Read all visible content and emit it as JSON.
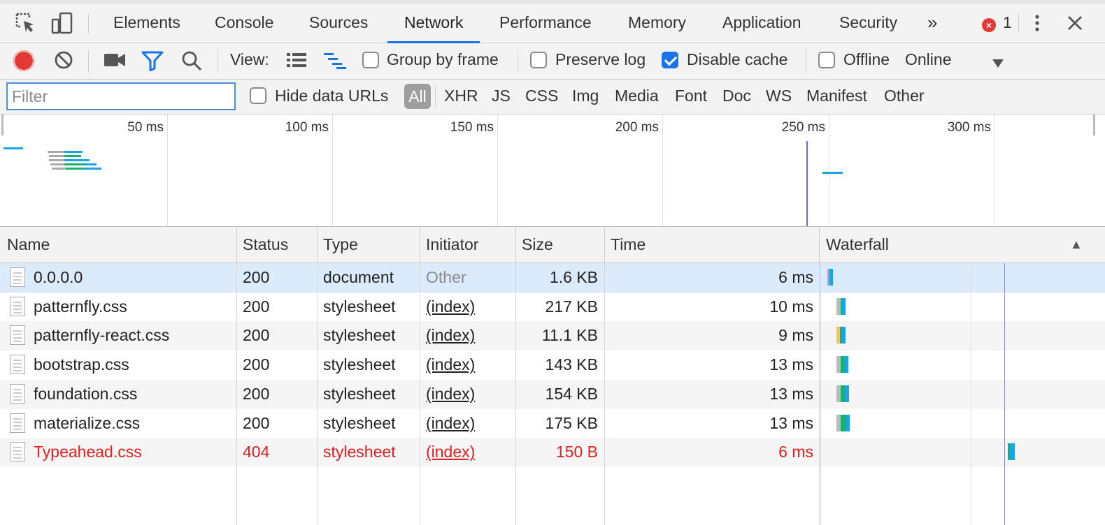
{
  "tabs": {
    "items": [
      "Elements",
      "Console",
      "Sources",
      "Network",
      "Performance",
      "Memory",
      "Application",
      "Security"
    ],
    "active": "Network",
    "more_label": "»",
    "error_badge": "×",
    "error_count": "1"
  },
  "toolbar": {
    "view_label": "View:",
    "group_by_frame": {
      "label": "Group by frame",
      "checked": false
    },
    "preserve_log": {
      "label": "Preserve log",
      "checked": false
    },
    "disable_cache": {
      "label": "Disable cache",
      "checked": true
    },
    "offline": {
      "label": "Offline",
      "checked": false
    },
    "throttle_value": "Online"
  },
  "filter": {
    "placeholder": "Filter",
    "hide_data_urls": {
      "label": "Hide data URLs",
      "checked": false
    },
    "types": [
      "All",
      "XHR",
      "JS",
      "CSS",
      "Img",
      "Media",
      "Font",
      "Doc",
      "WS",
      "Manifest",
      "Other"
    ],
    "active_type": "All"
  },
  "overview": {
    "ticks": [
      "50 ms",
      "100 ms",
      "150 ms",
      "200 ms",
      "250 ms",
      "300 ms"
    ]
  },
  "table": {
    "columns": [
      "Name",
      "Status",
      "Type",
      "Initiator",
      "Size",
      "Time",
      "Waterfall"
    ],
    "sort_indicator": "▲",
    "rows": [
      {
        "name": "0.0.0.0",
        "status": "200",
        "type": "document",
        "initiator": "Other",
        "size": "1.6 KB",
        "time": "6 ms",
        "selected": true,
        "error": false
      },
      {
        "name": "patternfly.css",
        "status": "200",
        "type": "stylesheet",
        "initiator": "(index)",
        "size": "217 KB",
        "time": "10 ms",
        "selected": false,
        "error": false
      },
      {
        "name": "patternfly-react.css",
        "status": "200",
        "type": "stylesheet",
        "initiator": "(index)",
        "size": "11.1 KB",
        "time": "9 ms",
        "selected": false,
        "error": false
      },
      {
        "name": "bootstrap.css",
        "status": "200",
        "type": "stylesheet",
        "initiator": "(index)",
        "size": "143 KB",
        "time": "13 ms",
        "selected": false,
        "error": false
      },
      {
        "name": "foundation.css",
        "status": "200",
        "type": "stylesheet",
        "initiator": "(index)",
        "size": "154 KB",
        "time": "13 ms",
        "selected": false,
        "error": false
      },
      {
        "name": "materialize.css",
        "status": "200",
        "type": "stylesheet",
        "initiator": "(index)",
        "size": "175 KB",
        "time": "13 ms",
        "selected": false,
        "error": false
      },
      {
        "name": "Typeahead.css",
        "status": "404",
        "type": "stylesheet",
        "initiator": "(index)",
        "size": "150 B",
        "time": "6 ms",
        "selected": false,
        "error": true
      }
    ]
  },
  "colors": {
    "accent": "#1a73e8",
    "error": "#e0201f",
    "selected_row": "#dcebfb",
    "alt_row": "#f5f5f5",
    "waterfall_waiting": "#15b36c",
    "waterfall_download": "#1aa3e8",
    "record_red": "#e53935"
  },
  "icons": [
    "inspect-icon",
    "device-toolbar-icon",
    "more-tabs-icon",
    "error-icon",
    "kebab-menu-icon",
    "close-icon",
    "record-icon",
    "clear-icon",
    "screenshot-icon",
    "filter-icon",
    "search-icon",
    "list-view-icon",
    "waterfall-view-icon",
    "dropdown-arrow-icon",
    "file-icon"
  ]
}
